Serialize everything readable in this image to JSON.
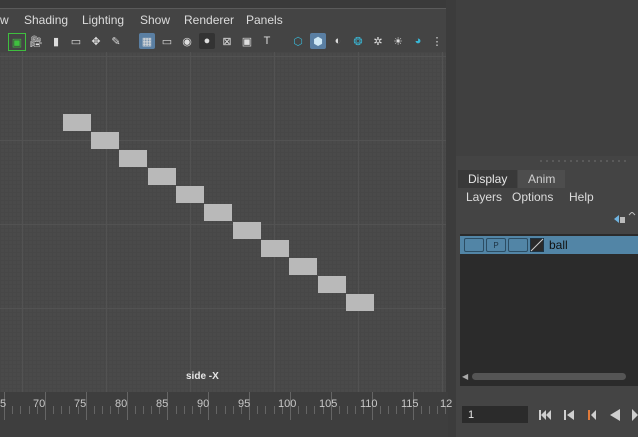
{
  "menu": {
    "items": [
      "w",
      "Shading",
      "Lighting",
      "Show",
      "Renderer",
      "Panels"
    ]
  },
  "viewport": {
    "camera_label": "side -X",
    "ball_positions_count": 11
  },
  "layer_editor": {
    "tabs": [
      "Display",
      "Anim"
    ],
    "active_tab": "Display",
    "menu": [
      "Layers",
      "Options",
      "Help"
    ],
    "layers": [
      {
        "visible_label": "",
        "playback_label": "P",
        "ref_label": "",
        "name": "ball"
      }
    ]
  },
  "timeline": {
    "labels": [
      "5",
      "70",
      "75",
      "80",
      "85",
      "90",
      "95",
      "100",
      "105",
      "110",
      "115",
      "12"
    ],
    "current_frame": "1"
  },
  "colors": {
    "accent": "#5285a6",
    "panel": "#444444",
    "dark": "#2b2b2b"
  }
}
